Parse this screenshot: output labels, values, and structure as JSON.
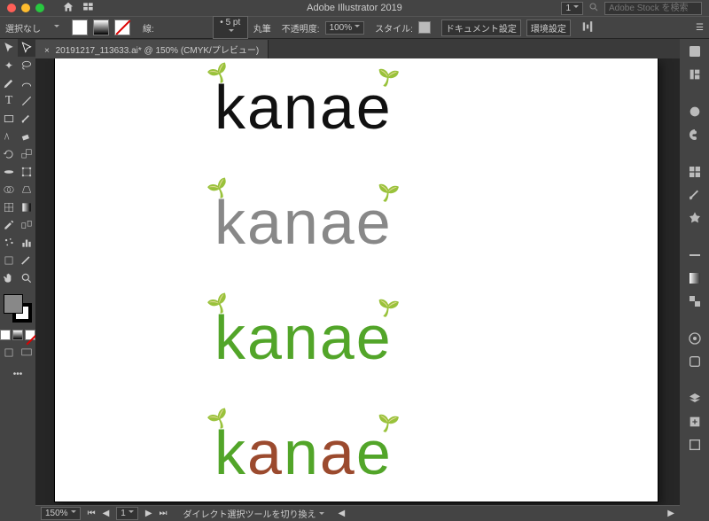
{
  "app": {
    "title": "Adobe Illustrator 2019"
  },
  "menubar": {
    "artboard_count": "1",
    "stock_placeholder": "Adobe Stock を検索"
  },
  "control": {
    "selection": "選択なし",
    "stroke_label": "線:",
    "stroke_pt": "5 pt",
    "cap_label": "丸筆",
    "opacity_label": "不透明度:",
    "opacity": "100%",
    "style_label": "スタイル:",
    "docsetup": "ドキュメント設定",
    "prefs": "環境設定"
  },
  "tab": {
    "label": "20191217_113633.ai* @ 150% (CMYK/プレビュー)"
  },
  "canvas": {
    "logo_text": "kanae",
    "logos": [
      {
        "class": "l1"
      },
      {
        "class": "l2"
      },
      {
        "class": "l3"
      },
      {
        "class": "l4"
      }
    ]
  },
  "status": {
    "zoom": "150%",
    "artboard": "1",
    "tool_hint": "ダイレクト選択ツールを切り換え"
  }
}
